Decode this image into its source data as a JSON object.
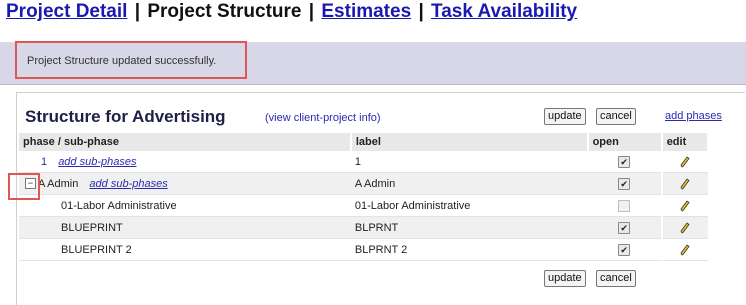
{
  "nav": {
    "project_detail": "Project Detail",
    "separator": "|",
    "project_structure": "Project Structure",
    "estimates": "Estimates",
    "task_availability": "Task Availability"
  },
  "message": {
    "text": "Project Structure updated successfully."
  },
  "structure": {
    "title": "Structure for Advertising",
    "view_info_link": "(view client-project info)",
    "update_label": "update",
    "cancel_label": "cancel",
    "add_phases_label": "add phases"
  },
  "table": {
    "headers": {
      "phase": "phase / sub-phase",
      "label": "label",
      "open": "open",
      "edit": "edit"
    },
    "rows": [
      {
        "phase": "1",
        "sub_link": "add sub-phases",
        "label": "1",
        "open": true
      },
      {
        "phase": "A Admin",
        "sub_link": "add sub-phases",
        "label": "A Admin",
        "open": true
      },
      {
        "phase": "01-Labor Administrative",
        "label": "01-Labor Administrative",
        "open": false
      },
      {
        "phase": "BLUEPRINT",
        "label": "BLPRNT",
        "open": true
      },
      {
        "phase": "BLUEPRINT 2",
        "label": "BLPRNT 2",
        "open": true
      }
    ]
  },
  "icons": {
    "edit": "pencil-icon",
    "collapse": "minus-box-icon"
  },
  "colors": {
    "link": "#1a1ab0",
    "message_bar": "#d7d7e8",
    "highlight": "#e05555",
    "header_bg": "#e8e8e8"
  }
}
